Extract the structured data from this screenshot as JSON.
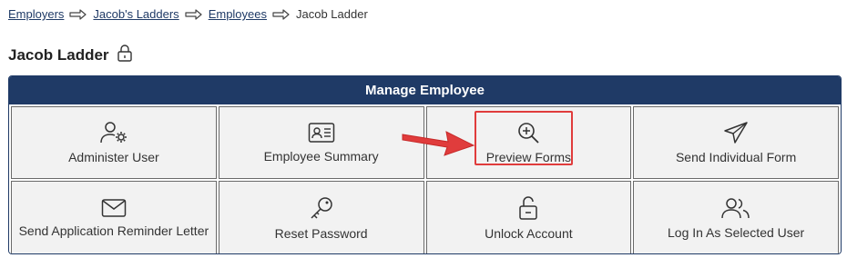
{
  "breadcrumb": {
    "items": [
      {
        "label": "Employers",
        "link": true
      },
      {
        "label": "Jacob's Ladders",
        "link": true
      },
      {
        "label": "Employees",
        "link": true
      },
      {
        "label": "Jacob Ladder",
        "link": false
      }
    ],
    "separator_icon": "arrow-right-icon"
  },
  "page": {
    "title": "Jacob Ladder",
    "title_icon": "lock-icon"
  },
  "panel": {
    "header": "Manage Employee",
    "header_color": "#1f3a66",
    "tiles": [
      {
        "label": "Administer User",
        "icon": "user-gear-icon"
      },
      {
        "label": "Employee Summary",
        "icon": "id-card-icon"
      },
      {
        "label": "Preview Forms",
        "icon": "zoom-in-icon",
        "highlighted": true
      },
      {
        "label": "Send Individual Form",
        "icon": "paper-plane-icon"
      },
      {
        "label": "Send Application Reminder Letter",
        "icon": "envelope-icon"
      },
      {
        "label": "Reset Password",
        "icon": "key-icon"
      },
      {
        "label": "Unlock Account",
        "icon": "unlock-icon"
      },
      {
        "label": "Log In As Selected User",
        "icon": "users-icon"
      }
    ]
  },
  "annotation": {
    "highlight_color": "#e03c3c",
    "arrow_icon": "callout-arrow-icon"
  }
}
